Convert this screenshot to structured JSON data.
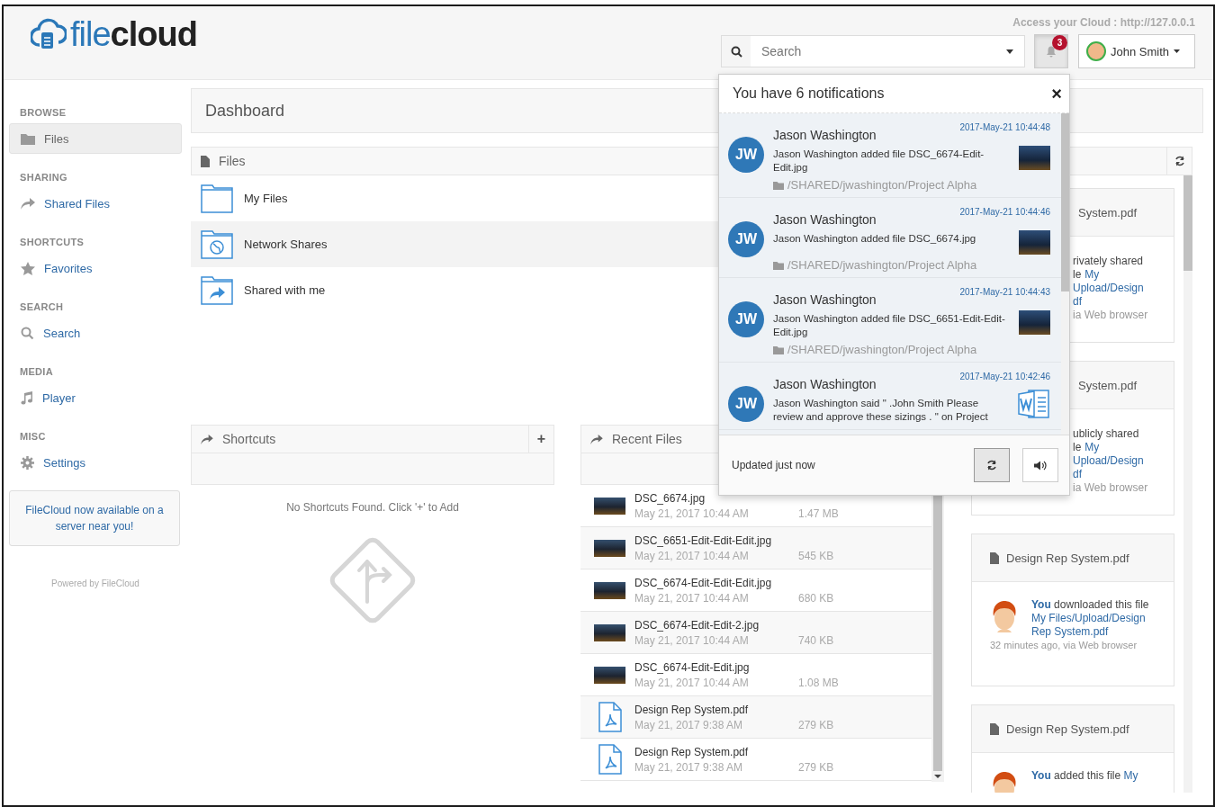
{
  "logo": {
    "part1": "file",
    "part2": "cloud"
  },
  "header": {
    "access": "Access your Cloud : http://127.0.0.1",
    "search": {
      "placeholder": "Search"
    },
    "notifications_badge": "3",
    "bell_pressed": true,
    "user": "John Smith"
  },
  "sidebar": {
    "sections": [
      {
        "heading": "BROWSE",
        "items": [
          {
            "label": "Files",
            "selected": true
          }
        ]
      },
      {
        "heading": "SHARING",
        "items": [
          {
            "label": "Shared Files",
            "selected": false
          }
        ]
      },
      {
        "heading": "SHORTCUTS",
        "items": [
          {
            "label": "Favorites",
            "selected": false
          }
        ]
      },
      {
        "heading": "SEARCH",
        "items": [
          {
            "label": "Search",
            "selected": false
          }
        ]
      },
      {
        "heading": "MEDIA",
        "items": [
          {
            "label": "Player",
            "selected": false
          }
        ]
      },
      {
        "heading": "MISC",
        "items": [
          {
            "label": "Settings",
            "selected": false
          }
        ]
      }
    ],
    "promo": "FileCloud now available on a server near you!",
    "powered": "Powered by FileCloud"
  },
  "dashboard": {
    "title": "Dashboard"
  },
  "files_panel": {
    "title": "Files",
    "rows": [
      {
        "label": "My Files",
        "selected": false
      },
      {
        "label": "Network Shares",
        "selected": true
      },
      {
        "label": "Shared with me",
        "selected": false
      }
    ]
  },
  "shortcuts_panel": {
    "title": "Shortcuts",
    "add": "+",
    "empty": "No Shortcuts Found. Click '+' to Add"
  },
  "recent_panel": {
    "title": "Recent Files",
    "rows": [
      {
        "name": "DSC_6674.jpg",
        "date": "May 21, 2017 10:44 AM",
        "size": "1.47 MB",
        "kind": "image"
      },
      {
        "name": "DSC_6651-Edit-Edit-Edit.jpg",
        "date": "May 21, 2017 10:44 AM",
        "size": "545 KB",
        "kind": "image"
      },
      {
        "name": "DSC_6674-Edit-Edit-Edit.jpg",
        "date": "May 21, 2017 10:44 AM",
        "size": "680 KB",
        "kind": "image"
      },
      {
        "name": "DSC_6674-Edit-Edit-2.jpg",
        "date": "May 21, 2017 10:44 AM",
        "size": "740 KB",
        "kind": "image"
      },
      {
        "name": "DSC_6674-Edit-Edit.jpg",
        "date": "May 21, 2017 10:44 AM",
        "size": "1.08 MB",
        "kind": "image"
      },
      {
        "name": "Design Rep System.pdf",
        "date": "May 21, 2017 9:38 AM",
        "size": "279 KB",
        "kind": "pdf"
      },
      {
        "name": "Design Rep System.pdf",
        "date": "May 21, 2017 9:38 AM",
        "size": "279 KB",
        "kind": "pdf"
      }
    ]
  },
  "activity_panel": {
    "cards": [
      {
        "kind": "covered",
        "title": "System.pdf",
        "lines": [
          [
            {
              "text": "rivately shared",
              "kind": "text"
            }
          ],
          [
            {
              "text": "le",
              "kind": "text"
            },
            {
              "text": "My",
              "kind": "link"
            }
          ],
          [
            {
              "text": "Upload/Design",
              "kind": "link"
            }
          ],
          [
            {
              "text": "df",
              "kind": "link"
            }
          ],
          [
            {
              "text": "ia Web browser",
              "kind": "muted"
            }
          ]
        ]
      },
      {
        "kind": "covered",
        "title": "System.pdf",
        "lines": [
          [
            {
              "text": "ublicly shared",
              "kind": "text"
            }
          ],
          [
            {
              "text": "le",
              "kind": "text"
            },
            {
              "text": "My",
              "kind": "link"
            }
          ],
          [
            {
              "text": "Upload/Design",
              "kind": "link"
            }
          ],
          [
            {
              "text": "df",
              "kind": "link"
            }
          ],
          [
            {
              "text": "ia Web browser",
              "kind": "muted"
            }
          ]
        ]
      },
      {
        "kind": "full",
        "title": "Design Rep System.pdf",
        "actor": "You",
        "action": "downloaded this file",
        "link": "My Files/Upload/Design Rep System.pdf",
        "time": "32 minutes ago, via Web browser"
      },
      {
        "kind": "full",
        "title": "Design Rep System.pdf",
        "actor": "You",
        "action": "added this file",
        "link": "My"
      }
    ]
  },
  "notifications": {
    "title": "You have 6 notifications",
    "close": "×",
    "items": [
      {
        "initials": "JW",
        "name": "Jason Washington",
        "date": "2017-May-21 10:44:48",
        "message": "Jason Washington added file DSC_6674-Edit-Edit.jpg",
        "path": "/SHARED/jwashington/Project Alpha",
        "kind": "photo"
      },
      {
        "initials": "JW",
        "name": "Jason Washington",
        "date": "2017-May-21 10:44:46",
        "message": "Jason Washington added file DSC_6674.jpg",
        "path": "/SHARED/jwashington/Project Alpha",
        "kind": "photo"
      },
      {
        "initials": "JW",
        "name": "Jason Washington",
        "date": "2017-May-21 10:44:43",
        "message": "Jason Washington added file DSC_6651-Edit-Edit-Edit.jpg",
        "path": "/SHARED/jwashington/Project Alpha",
        "kind": "photo"
      },
      {
        "initials": "JW",
        "name": "Jason Washington",
        "date": "2017-May-21 10:42:46",
        "message": "Jason Washington said \" .John Smith Please review and approve these sizings . \" on Project",
        "kind": "word"
      }
    ],
    "footer": "Updated just now",
    "refresh_pressed": true
  }
}
